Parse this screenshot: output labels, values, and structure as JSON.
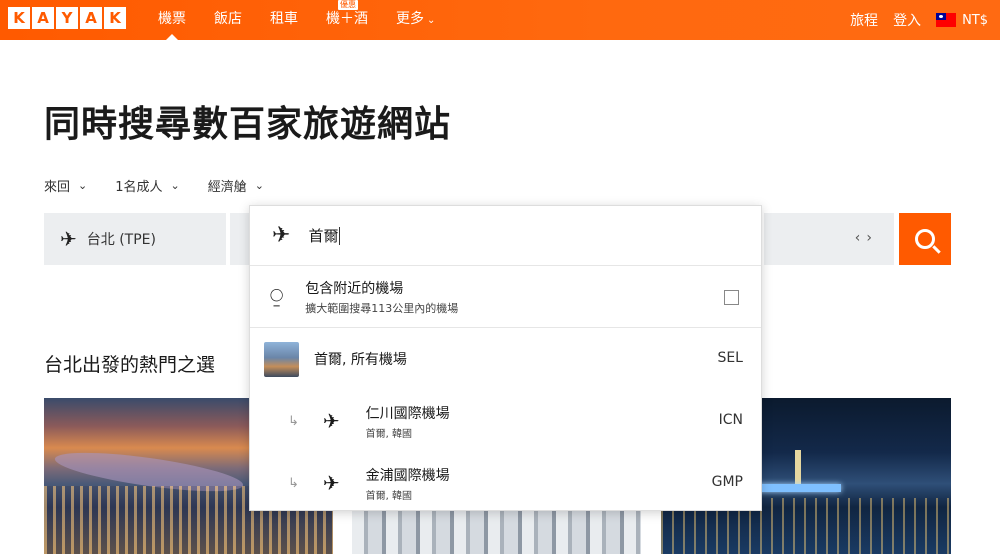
{
  "brand": {
    "letters": [
      "K",
      "A",
      "Y",
      "A",
      "K"
    ]
  },
  "nav": {
    "items": [
      {
        "label": "機票",
        "active": true
      },
      {
        "label": "飯店"
      },
      {
        "label": "租車"
      },
      {
        "label": "機＋酒",
        "badge": "優惠"
      },
      {
        "label": "更多"
      }
    ],
    "more_chevron": "⌄",
    "trips": "旅程",
    "login": "登入",
    "currency": "NT$"
  },
  "hero": {
    "title": "同時搜尋數百家旅遊網站"
  },
  "trip_options": {
    "trip_type": "來回",
    "travelers": "1名成人",
    "cabin": "經濟艙",
    "chevron": "⌄"
  },
  "search": {
    "origin": "台北 (TPE)",
    "date_prev": "‹",
    "date_next": "›"
  },
  "dropdown": {
    "query": "首爾",
    "nearby": {
      "title": "包含附近的機場",
      "subtitle": "擴大範圍搜尋113公里內的機場"
    },
    "results": [
      {
        "type": "city",
        "name": "首爾, 所有機場",
        "code": "SEL"
      },
      {
        "type": "airport",
        "name": "仁川國際機場",
        "sub": "首爾, 韓國",
        "code": "ICN"
      },
      {
        "type": "airport",
        "name": "金浦國際機場",
        "sub": "首爾, 韓國",
        "code": "GMP"
      }
    ]
  },
  "popular": {
    "title": "台北出發的熱門之選"
  },
  "icons": {
    "plane": "✈",
    "antenna": "⍜",
    "sub_arrow": "↳"
  },
  "colors": {
    "brand": "#ff5a00",
    "field_bg": "#eceef0"
  }
}
